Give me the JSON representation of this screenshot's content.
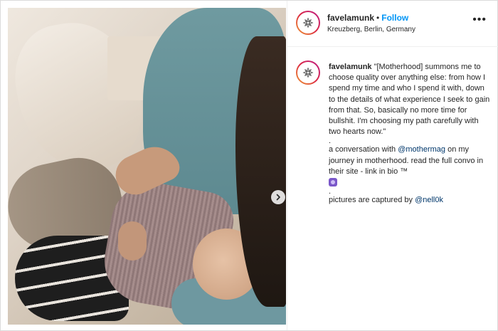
{
  "post": {
    "username": "favelamunk",
    "separator": "•",
    "follow_label": "Follow",
    "location": "Kreuzberg, Berlin, Germany",
    "more_label": "•••"
  },
  "caption": {
    "username": "favelamunk",
    "quote": "\"[Motherhood] summons me to choose quality over anything else: from how I spend my time and who I spend it with, down to the details of what experience I seek to gain from that. So, basically no more time for bullshit. I'm choosing my path carefully with two hearts now.\"",
    "sep1": ".",
    "para2_before": "a conversation with ",
    "para2_mention": "@mothermag",
    "para2_after": " on my journey in motherhood. read the full convo in their site - link in bio ™",
    "sep2": ".",
    "para3_before": "pictures are captured by ",
    "para3_mention": "@nell0k"
  },
  "icons": {
    "avatar": "lotus-mandala-icon",
    "carousel": "chevron-right-icon",
    "emoji": "purple-emoji-icon",
    "more": "more-options-icon"
  },
  "colors": {
    "follow": "#0095f6",
    "mention": "#00376b",
    "text": "#262626",
    "border": "#dbdbdb"
  }
}
